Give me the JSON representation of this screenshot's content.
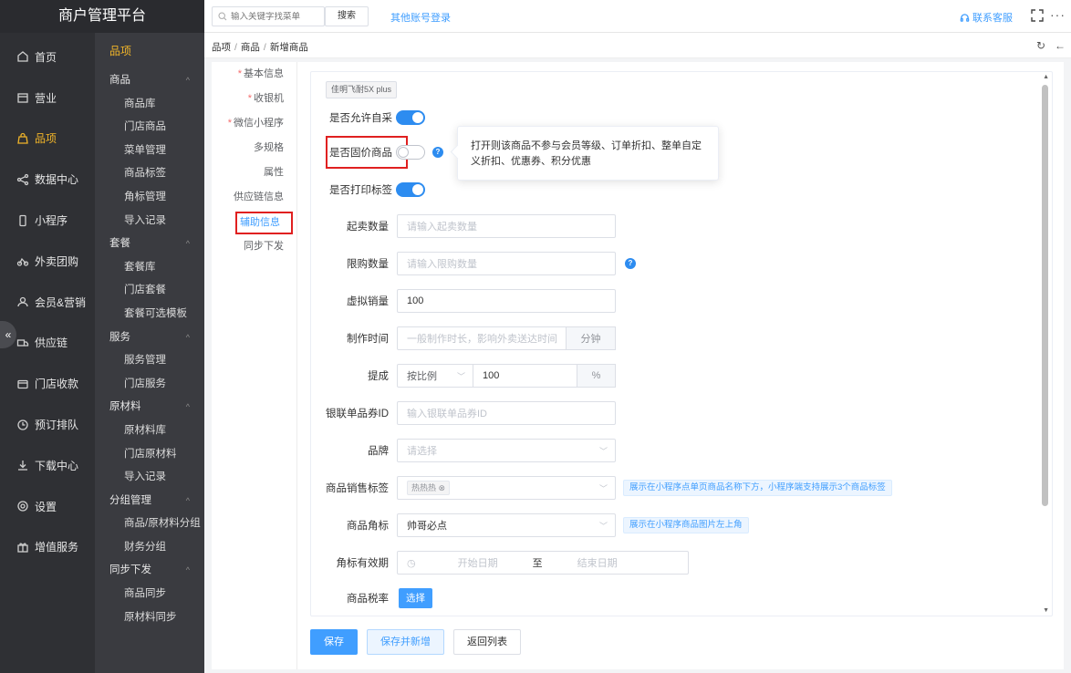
{
  "app": {
    "title": "商户管理平台"
  },
  "header": {
    "search_placeholder": "输入关键字找菜单",
    "search_button": "搜索",
    "other_login": "其他账号登录",
    "contact": "联系客服"
  },
  "breadcrumb": [
    "品项",
    "商品",
    "新增商品"
  ],
  "nav1": [
    {
      "label": "首页",
      "icon": "home-icon"
    },
    {
      "label": "营业",
      "icon": "calendar-icon"
    },
    {
      "label": "品项",
      "icon": "bag-icon",
      "active": true
    },
    {
      "label": "数据中心",
      "icon": "share-icon"
    },
    {
      "label": "小程序",
      "icon": "mobile-icon"
    },
    {
      "label": "外卖团购",
      "icon": "bike-icon"
    },
    {
      "label": "会员&营销",
      "icon": "user-icon"
    },
    {
      "label": "供应链",
      "icon": "truck-icon"
    },
    {
      "label": "门店收款",
      "icon": "wallet-icon"
    },
    {
      "label": "预订排队",
      "icon": "clock-icon"
    },
    {
      "label": "下载中心",
      "icon": "download-icon"
    },
    {
      "label": "设置",
      "icon": "gear-icon"
    },
    {
      "label": "增值服务",
      "icon": "gift-icon"
    }
  ],
  "nav2": {
    "title": "品项",
    "groups": [
      {
        "label": "商品",
        "items": [
          "商品库",
          "门店商品",
          "菜单管理",
          "商品标签",
          "角标管理",
          "导入记录"
        ]
      },
      {
        "label": "套餐",
        "items": [
          "套餐库",
          "门店套餐",
          "套餐可选模板"
        ]
      },
      {
        "label": "服务",
        "items": [
          "服务管理",
          "门店服务"
        ]
      },
      {
        "label": "原材料",
        "items": [
          "原材料库",
          "门店原材料",
          "导入记录"
        ]
      },
      {
        "label": "分组管理",
        "items": [
          "商品/原材料分组",
          "财务分组"
        ]
      },
      {
        "label": "同步下发",
        "items": [
          "商品同步",
          "原材料同步"
        ]
      }
    ]
  },
  "form_tabs": [
    {
      "label": "基本信息",
      "required": true
    },
    {
      "label": "收银机",
      "required": true
    },
    {
      "label": "微信小程序",
      "required": true
    },
    {
      "label": "多规格",
      "required": false
    },
    {
      "label": "属性",
      "required": false
    },
    {
      "label": "供应链信息",
      "required": false
    },
    {
      "label": "辅助信息",
      "required": false,
      "active": true
    },
    {
      "label": "同步下发",
      "required": false
    }
  ],
  "form": {
    "product_tag": "佳明飞耐5X plus",
    "allow_self_purchase": {
      "label": "是否允许自采",
      "on": true
    },
    "fixed_price": {
      "label": "是否固价商品",
      "on": false
    },
    "tooltip": "打开则该商品不参与会员等级、订单折扣、整单自定义折扣、优惠券、积分优惠",
    "print_label": {
      "label": "是否打印标签",
      "on": true
    },
    "min_qty": {
      "label": "起卖数量",
      "placeholder": "请输入起卖数量"
    },
    "limit_qty": {
      "label": "限购数量",
      "placeholder": "请输入限购数量"
    },
    "virtual_sales": {
      "label": "虚拟销量",
      "value": "100"
    },
    "make_time": {
      "label": "制作时间",
      "placeholder": "一般制作时长，影响外卖送达时间",
      "unit": "分钟"
    },
    "commission": {
      "label": "提成",
      "mode": "按比例",
      "value": "100",
      "unit": "%"
    },
    "unionpay_id": {
      "label": "银联单品券ID",
      "placeholder": "输入银联单品券ID"
    },
    "brand": {
      "label": "品牌",
      "placeholder": "请选择"
    },
    "sales_tag": {
      "label": "商品销售标签",
      "tag": "热热热",
      "hint": "展示在小程序点单页商品名称下方，小程序端支持展示3个商品标签"
    },
    "corner_mark": {
      "label": "商品角标",
      "value": "帅哥必点",
      "hint": "展示在小程序商品图片左上角"
    },
    "corner_valid": {
      "label": "角标有效期",
      "start": "开始日期",
      "to": "至",
      "end": "结束日期"
    },
    "tax": {
      "label": "商品税率",
      "button": "选择"
    }
  },
  "actions": {
    "save": "保存",
    "save_new": "保存并新增",
    "back": "返回列表"
  },
  "colors": {
    "primary": "#409eff",
    "accent": "#f0b429",
    "highlight": "#e02020",
    "sidebar": "#2f3034"
  }
}
